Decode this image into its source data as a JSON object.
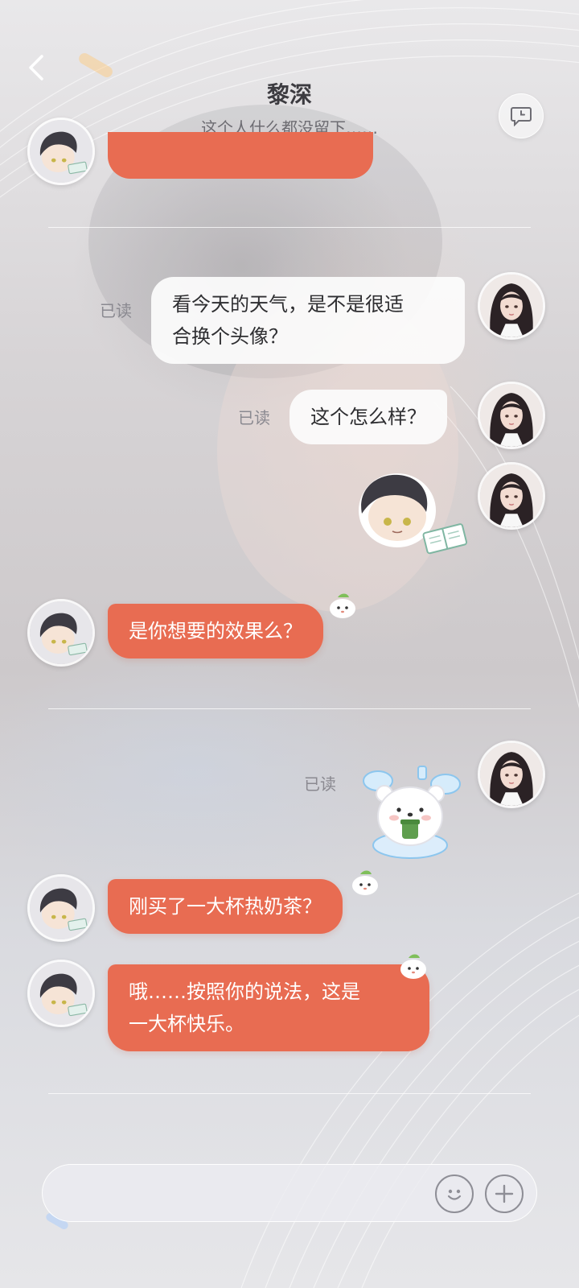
{
  "header": {
    "contact_name": "黎深",
    "contact_status": "这个人什么都没留下……"
  },
  "messages": [
    {
      "side": "incoming",
      "type": "text",
      "text": "",
      "partially_visible": true
    },
    {
      "side": "outgoing",
      "type": "text",
      "lines": [
        "看今天的天气，是不是很适",
        "合换个头像？"
      ],
      "read_label": "已读"
    },
    {
      "side": "outgoing",
      "type": "text",
      "lines": [
        "这个怎么样？"
      ],
      "read_label": "已读"
    },
    {
      "side": "outgoing",
      "type": "sticker",
      "sticker": "chibi-boy-reading-sticker"
    },
    {
      "side": "incoming",
      "type": "text",
      "lines": [
        "是你想要的效果么？"
      ]
    },
    {
      "side": "outgoing",
      "type": "sticker",
      "sticker": "bear-holding-cup-sticker",
      "read_label": "已读"
    },
    {
      "side": "incoming",
      "type": "text",
      "lines": [
        "刚买了一大杯热奶茶？"
      ]
    },
    {
      "side": "incoming",
      "type": "text",
      "lines": [
        "哦……按照你的说法，这是",
        "一大杯快乐。"
      ]
    }
  ],
  "input": {
    "value": "",
    "placeholder": ""
  },
  "icons": {
    "back": "chevron-left-icon",
    "history": "chat-history-icon",
    "emoji": "smiley-icon",
    "add": "plus-icon"
  },
  "colors": {
    "incoming_bubble": "#e86c52",
    "outgoing_bubble": "#fcfcfc",
    "text_dark": "#3c3b40",
    "read_label": "#8a8990"
  }
}
